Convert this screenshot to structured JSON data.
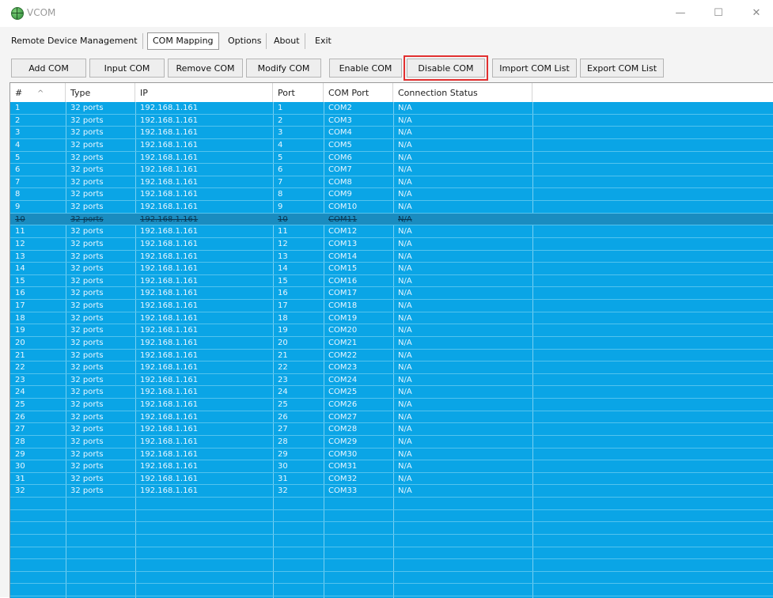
{
  "window": {
    "title": "VCOM",
    "controls": {
      "minimize": "—",
      "maximize": "☐",
      "close": "✕"
    }
  },
  "menu": [
    {
      "label": "Remote Device Management",
      "active": false
    },
    {
      "label": "COM Mapping",
      "active": true
    },
    {
      "label": "Options",
      "active": false
    },
    {
      "label": "About",
      "active": false
    },
    {
      "label": "Exit",
      "active": false
    }
  ],
  "toolbar": {
    "buttons": [
      {
        "label": "Add COM"
      },
      {
        "label": "Input COM"
      },
      {
        "label": "Remove COM"
      },
      {
        "label": "Modify COM"
      },
      {
        "label": "Enable COM"
      },
      {
        "label": "Disable COM",
        "highlighted": true
      },
      {
        "label": "Import COM List"
      },
      {
        "label": "Export COM List"
      }
    ]
  },
  "table": {
    "columns": [
      "#",
      "Type",
      "IP",
      "Port",
      "COM Port",
      "Connection Status"
    ],
    "selected_row": 10,
    "rows": [
      [
        "1",
        "32 ports",
        "192.168.1.161",
        "1",
        "COM2",
        "N/A"
      ],
      [
        "2",
        "32 ports",
        "192.168.1.161",
        "2",
        "COM3",
        "N/A"
      ],
      [
        "3",
        "32 ports",
        "192.168.1.161",
        "3",
        "COM4",
        "N/A"
      ],
      [
        "4",
        "32 ports",
        "192.168.1.161",
        "4",
        "COM5",
        "N/A"
      ],
      [
        "5",
        "32 ports",
        "192.168.1.161",
        "5",
        "COM6",
        "N/A"
      ],
      [
        "6",
        "32 ports",
        "192.168.1.161",
        "6",
        "COM7",
        "N/A"
      ],
      [
        "7",
        "32 ports",
        "192.168.1.161",
        "7",
        "COM8",
        "N/A"
      ],
      [
        "8",
        "32 ports",
        "192.168.1.161",
        "8",
        "COM9",
        "N/A"
      ],
      [
        "9",
        "32 ports",
        "192.168.1.161",
        "9",
        "COM10",
        "N/A"
      ],
      [
        "10",
        "32 ports",
        "192.168.1.161",
        "10",
        "COM11",
        "N/A"
      ],
      [
        "11",
        "32 ports",
        "192.168.1.161",
        "11",
        "COM12",
        "N/A"
      ],
      [
        "12",
        "32 ports",
        "192.168.1.161",
        "12",
        "COM13",
        "N/A"
      ],
      [
        "13",
        "32 ports",
        "192.168.1.161",
        "13",
        "COM14",
        "N/A"
      ],
      [
        "14",
        "32 ports",
        "192.168.1.161",
        "14",
        "COM15",
        "N/A"
      ],
      [
        "15",
        "32 ports",
        "192.168.1.161",
        "15",
        "COM16",
        "N/A"
      ],
      [
        "16",
        "32 ports",
        "192.168.1.161",
        "16",
        "COM17",
        "N/A"
      ],
      [
        "17",
        "32 ports",
        "192.168.1.161",
        "17",
        "COM18",
        "N/A"
      ],
      [
        "18",
        "32 ports",
        "192.168.1.161",
        "18",
        "COM19",
        "N/A"
      ],
      [
        "19",
        "32 ports",
        "192.168.1.161",
        "19",
        "COM20",
        "N/A"
      ],
      [
        "20",
        "32 ports",
        "192.168.1.161",
        "20",
        "COM21",
        "N/A"
      ],
      [
        "21",
        "32 ports",
        "192.168.1.161",
        "21",
        "COM22",
        "N/A"
      ],
      [
        "22",
        "32 ports",
        "192.168.1.161",
        "22",
        "COM23",
        "N/A"
      ],
      [
        "23",
        "32 ports",
        "192.168.1.161",
        "23",
        "COM24",
        "N/A"
      ],
      [
        "24",
        "32 ports",
        "192.168.1.161",
        "24",
        "COM25",
        "N/A"
      ],
      [
        "25",
        "32 ports",
        "192.168.1.161",
        "25",
        "COM26",
        "N/A"
      ],
      [
        "26",
        "32 ports",
        "192.168.1.161",
        "26",
        "COM27",
        "N/A"
      ],
      [
        "27",
        "32 ports",
        "192.168.1.161",
        "27",
        "COM28",
        "N/A"
      ],
      [
        "28",
        "32 ports",
        "192.168.1.161",
        "28",
        "COM29",
        "N/A"
      ],
      [
        "29",
        "32 ports",
        "192.168.1.161",
        "29",
        "COM30",
        "N/A"
      ],
      [
        "30",
        "32 ports",
        "192.168.1.161",
        "30",
        "COM31",
        "N/A"
      ],
      [
        "31",
        "32 ports",
        "192.168.1.161",
        "31",
        "COM32",
        "N/A"
      ],
      [
        "32",
        "32 ports",
        "192.168.1.161",
        "32",
        "COM33",
        "N/A"
      ]
    ]
  },
  "colors": {
    "row_bg": "#0aa5e6",
    "selected_row_bg": "#1a8cc0",
    "highlight_outline": "#e23030"
  }
}
